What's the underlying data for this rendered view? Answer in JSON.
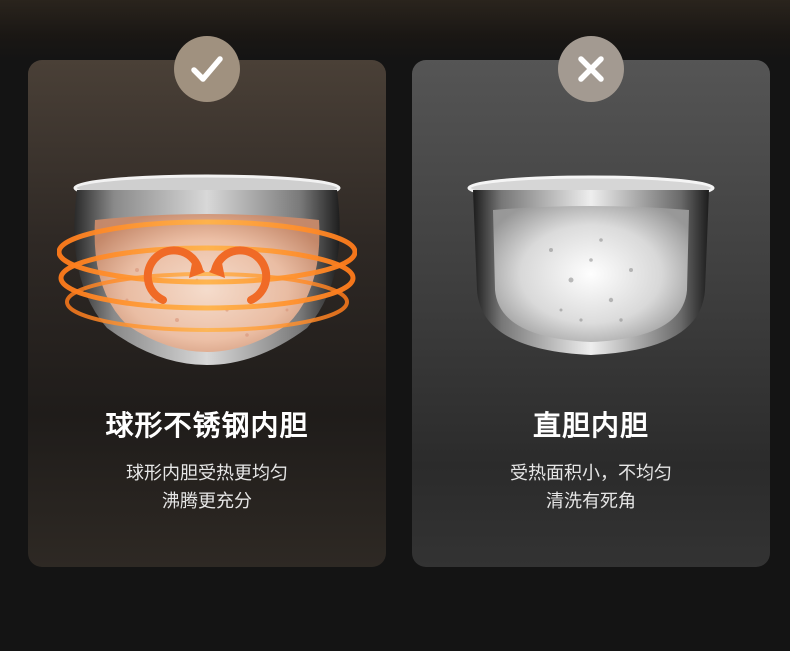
{
  "left_card": {
    "badge_icon": "check-icon",
    "title": "球形不锈钢内胆",
    "desc_line1": "球形内胆受热更均匀",
    "desc_line2": "沸腾更充分",
    "accent_color": "#f07a20"
  },
  "right_card": {
    "badge_icon": "close-icon",
    "title": "直胆内胆",
    "desc_line1": "受热面积小，不均匀",
    "desc_line2": "清洗有死角"
  }
}
